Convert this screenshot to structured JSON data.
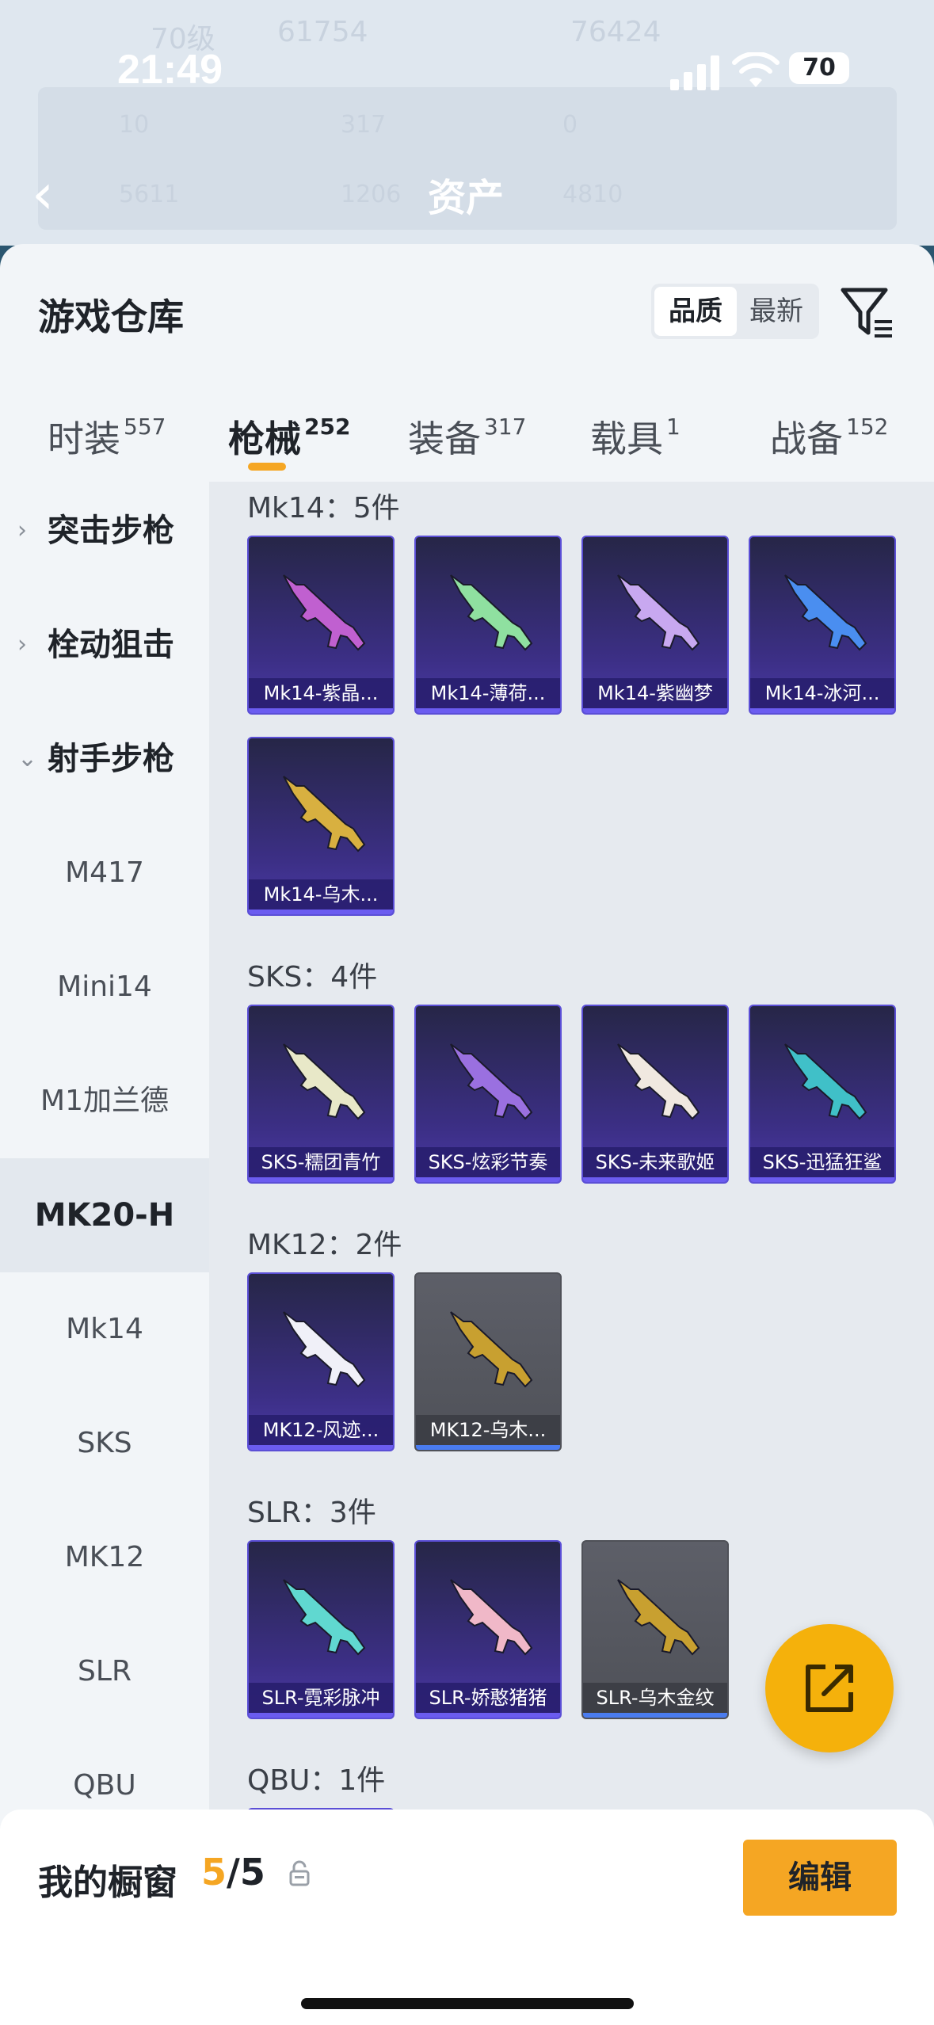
{
  "background": {
    "header_title": "资产",
    "ghost_texts": [
      "70级",
      "61754",
      "76424",
      "10",
      "317",
      "0",
      "5611",
      "1206",
      "4810"
    ]
  },
  "status_bar": {
    "time": "21:49",
    "battery": "70"
  },
  "sheet": {
    "title": "游戏仓库",
    "sort": {
      "quality": "品质",
      "latest": "最新"
    },
    "tabs": [
      {
        "label": "时装",
        "count": "557"
      },
      {
        "label": "枪械",
        "count": "252"
      },
      {
        "label": "装备",
        "count": "317"
      },
      {
        "label": "载具",
        "count": "1"
      },
      {
        "label": "战备",
        "count": "152"
      }
    ]
  },
  "sidebar": {
    "items": [
      {
        "label": "突击步枪",
        "type": "category",
        "chevron": "›"
      },
      {
        "label": "栓动狙击",
        "type": "category",
        "chevron": "›"
      },
      {
        "label": "射手步枪",
        "type": "category",
        "chevron": "⌄"
      },
      {
        "label": "M417",
        "type": "sub"
      },
      {
        "label": "Mini14",
        "type": "sub"
      },
      {
        "label": "M1加兰德",
        "type": "sub"
      },
      {
        "label": "MK20-H",
        "type": "selected"
      },
      {
        "label": "Mk14",
        "type": "sub"
      },
      {
        "label": "SKS",
        "type": "sub"
      },
      {
        "label": "MK12",
        "type": "sub"
      },
      {
        "label": "SLR",
        "type": "sub"
      },
      {
        "label": "QBU",
        "type": "sub"
      }
    ]
  },
  "sections": [
    {
      "title": "Mk14：5件",
      "items": [
        {
          "name": "Mk14-紫晶...",
          "style": "purple",
          "color": "#c060d0"
        },
        {
          "name": "Mk14-薄荷...",
          "style": "purple",
          "color": "#8fe0a0"
        },
        {
          "name": "Mk14-紫幽梦",
          "style": "purple",
          "color": "#c8a8f0"
        },
        {
          "name": "Mk14-冰河...",
          "style": "purple",
          "color": "#4a8ef0"
        },
        {
          "name": "Mk14-乌木...",
          "style": "purple",
          "color": "#d8b040"
        }
      ]
    },
    {
      "title": "SKS：4件",
      "items": [
        {
          "name": "SKS-糯团青竹",
          "style": "purple",
          "color": "#e8e8c8"
        },
        {
          "name": "SKS-炫彩节奏",
          "style": "purple",
          "color": "#9a70e0"
        },
        {
          "name": "SKS-未来歌姬",
          "style": "purple",
          "color": "#f0e8e0"
        },
        {
          "name": "SKS-迅猛狂鲨",
          "style": "purple",
          "color": "#40c0c8"
        }
      ]
    },
    {
      "title": "MK12：2件",
      "items": [
        {
          "name": "MK12-风迹...",
          "style": "purple",
          "color": "#f0f0f8"
        },
        {
          "name": "MK12-乌木...",
          "style": "gray",
          "color": "#c8a030"
        }
      ]
    },
    {
      "title": "SLR：3件",
      "items": [
        {
          "name": "SLR-霓彩脉冲",
          "style": "purple",
          "color": "#60d8d0"
        },
        {
          "name": "SLR-娇憨猪猪",
          "style": "purple",
          "color": "#f0b8c8"
        },
        {
          "name": "SLR-乌木金纹",
          "style": "gray",
          "color": "#c8a030"
        }
      ]
    },
    {
      "title": "QBU：1件",
      "items": [
        {
          "name": "",
          "style": "purple",
          "color": "#e05050"
        }
      ]
    }
  ],
  "showcase": {
    "title": "我的橱窗",
    "current": "5",
    "total": "/5",
    "edit_label": "编辑"
  }
}
